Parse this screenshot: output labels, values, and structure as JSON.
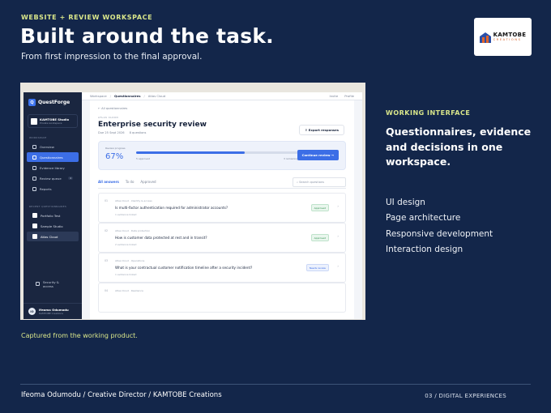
{
  "header": {
    "kicker": "WEBSITE + REVIEW WORKSPACE",
    "title": "Built around the task.",
    "subtitle": "From first impression to the final approval."
  },
  "logo": {
    "name": "KAMTOBE",
    "tagline": "CREATIONS",
    "colors": {
      "blue": "#2a4fa8",
      "orange": "#e0642a"
    }
  },
  "app": {
    "brand": "QuestForge",
    "workspace": {
      "name": "KAMTOBE Studio",
      "sub": "Private workspace"
    },
    "workspace_section": "WORKSPACE",
    "nav": [
      {
        "label": "Overview",
        "icon": "grid-icon",
        "active": false
      },
      {
        "label": "Questionnaires",
        "icon": "list-icon",
        "active": true
      },
      {
        "label": "Evidence library",
        "icon": "folder-icon",
        "active": false
      },
      {
        "label": "Review queue",
        "icon": "inbox-icon",
        "active": false,
        "badge": "4"
      },
      {
        "label": "Reports",
        "icon": "chart-icon",
        "active": false
      }
    ],
    "recent_section": "RECENT QUESTIONNAIRES",
    "recent": [
      {
        "label": "Portfolio Test",
        "active": false
      },
      {
        "label": "Sample Studio",
        "active": false
      },
      {
        "label": "Atlas Cloud",
        "active": true
      }
    ],
    "security": "Security & access",
    "user": {
      "initials": "IO",
      "name": "Ifeoma Odumodu",
      "org": "KAMTOBE Creations"
    },
    "breadcrumb": [
      "Workspace",
      "Questionnaires",
      "Atlas Cloud"
    ],
    "top_actions": [
      "Invite",
      "Profile"
    ],
    "back": "All questionnaires",
    "section_label": "ATLAS CLOUD",
    "page_title": "Enterprise security review",
    "meta_due": "Due 25 Sept 2026",
    "meta_count": "8 questions",
    "export": "Export responses",
    "progress": {
      "label": "Review progress",
      "value": 67,
      "display": "67%",
      "approved_text": "5 approved",
      "remaining_text": "3 remaining"
    },
    "continue": "Continue review",
    "tabs": [
      {
        "label": "All answers",
        "active": true
      },
      {
        "label": "To do",
        "active": false
      },
      {
        "label": "Approved",
        "active": false
      }
    ],
    "search_placeholder": "Search questions",
    "questions": [
      {
        "num": "01",
        "meta": "Atlas Cloud  ·  Identity & access",
        "text": "Is multi-factor authentication required for administrator accounts?",
        "evidence": "1 evidence linked",
        "status": "Approved",
        "kind": "approved"
      },
      {
        "num": "02",
        "meta": "Atlas Cloud  ·  Data protection",
        "text": "How is customer data protected at rest and in transit?",
        "evidence": "2 evidence linked",
        "status": "Approved",
        "kind": "approved"
      },
      {
        "num": "03",
        "meta": "Atlas Cloud  ·  Operations",
        "text": "What is your contractual customer notification timeline after a security incident?",
        "evidence": "1 evidence linked",
        "status": "Needs review",
        "kind": "review"
      },
      {
        "num": "04",
        "meta": "Atlas Cloud  ·  Resilience",
        "text": "",
        "evidence": "",
        "status": "",
        "kind": ""
      }
    ]
  },
  "caption": "Captured from the working product.",
  "right": {
    "kicker": "WORKING INTERFACE",
    "headline": "Questionnaires, evidence and decisions in one workspace.",
    "services": [
      "UI design",
      "Page architecture",
      "Responsive development",
      "Interaction design"
    ]
  },
  "footer": {
    "credit": "Ifeoma Odumodu  /  Creative Director  /  KAMTOBE Creations",
    "page": "03  /  DIGITAL EXPERIENCES"
  }
}
